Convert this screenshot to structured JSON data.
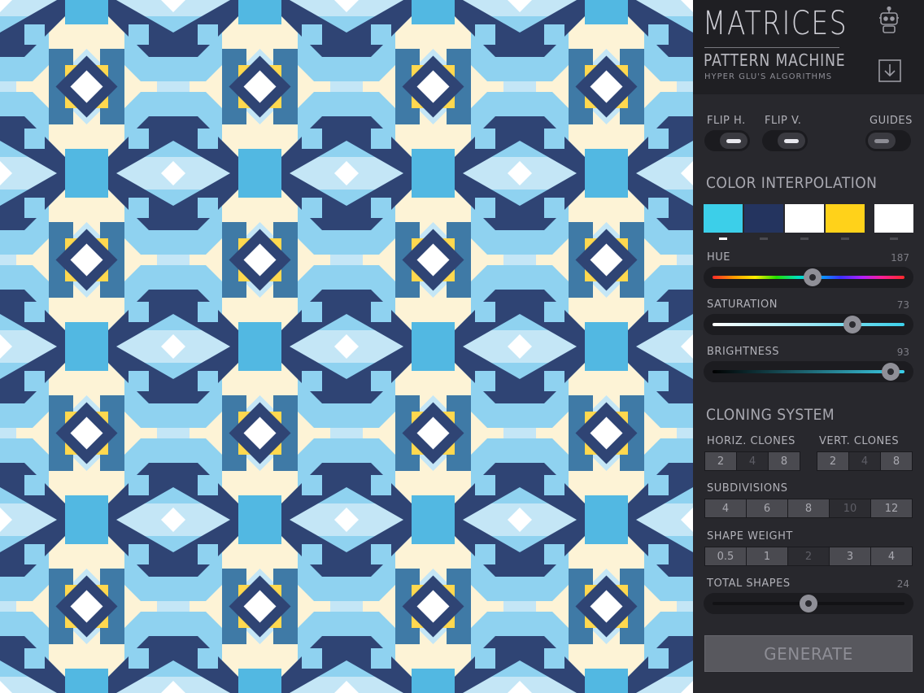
{
  "header": {
    "title": "MATRICES",
    "subtitle": "PATTERN MACHINE",
    "author": "HYPER GLU'S ALGORITHMS",
    "robot_icon": "robot-icon",
    "download_icon": "download-icon"
  },
  "toggles": [
    {
      "label": "FLIP H.",
      "on": true
    },
    {
      "label": "FLIP V.",
      "on": true
    },
    {
      "label": "GUIDES",
      "on": false
    }
  ],
  "color_interpolation": {
    "title": "COLOR INTERPOLATION",
    "swatches": [
      "#3ccfe9",
      "#24345f",
      "#ffffff",
      "#ffd21a",
      "#ffffff"
    ],
    "selected_index": 0
  },
  "sliders": {
    "hue": {
      "label": "HUE",
      "value": "187",
      "fraction": 0.52
    },
    "saturation": {
      "label": "SATURATION",
      "value": "73",
      "fraction": 0.73
    },
    "brightness": {
      "label": "BRIGHTNESS",
      "value": "93",
      "fraction": 0.93
    },
    "total_shapes": {
      "label": "TOTAL SHAPES",
      "value": "24",
      "fraction": 0.5
    }
  },
  "cloning_system": {
    "title": "CLONING SYSTEM",
    "horiz_clones": {
      "label": "HORIZ. CLONES",
      "options": [
        "2",
        "4",
        "8"
      ],
      "selected": 1
    },
    "vert_clones": {
      "label": "VERT. CLONES",
      "options": [
        "2",
        "4",
        "8"
      ],
      "selected": 1
    },
    "subdivisions": {
      "label": "SUBDIVISIONS",
      "options": [
        "4",
        "6",
        "8",
        "10",
        "12"
      ],
      "selected": 3
    },
    "shape_weight": {
      "label": "SHAPE WEIGHT",
      "options": [
        "0.5",
        "1",
        "2",
        "3",
        "4"
      ],
      "selected": 2
    }
  },
  "generate_label": "GENERATE",
  "pattern_colors": {
    "navy": "#2f4474",
    "steel": "#3f7aa6",
    "blue": "#52b8e2",
    "light_blue": "#8fd2f0",
    "pale_blue": "#c4e6f6",
    "yellow": "#ffd84f",
    "cream": "#fdf3d6",
    "white": "#ffffff"
  }
}
